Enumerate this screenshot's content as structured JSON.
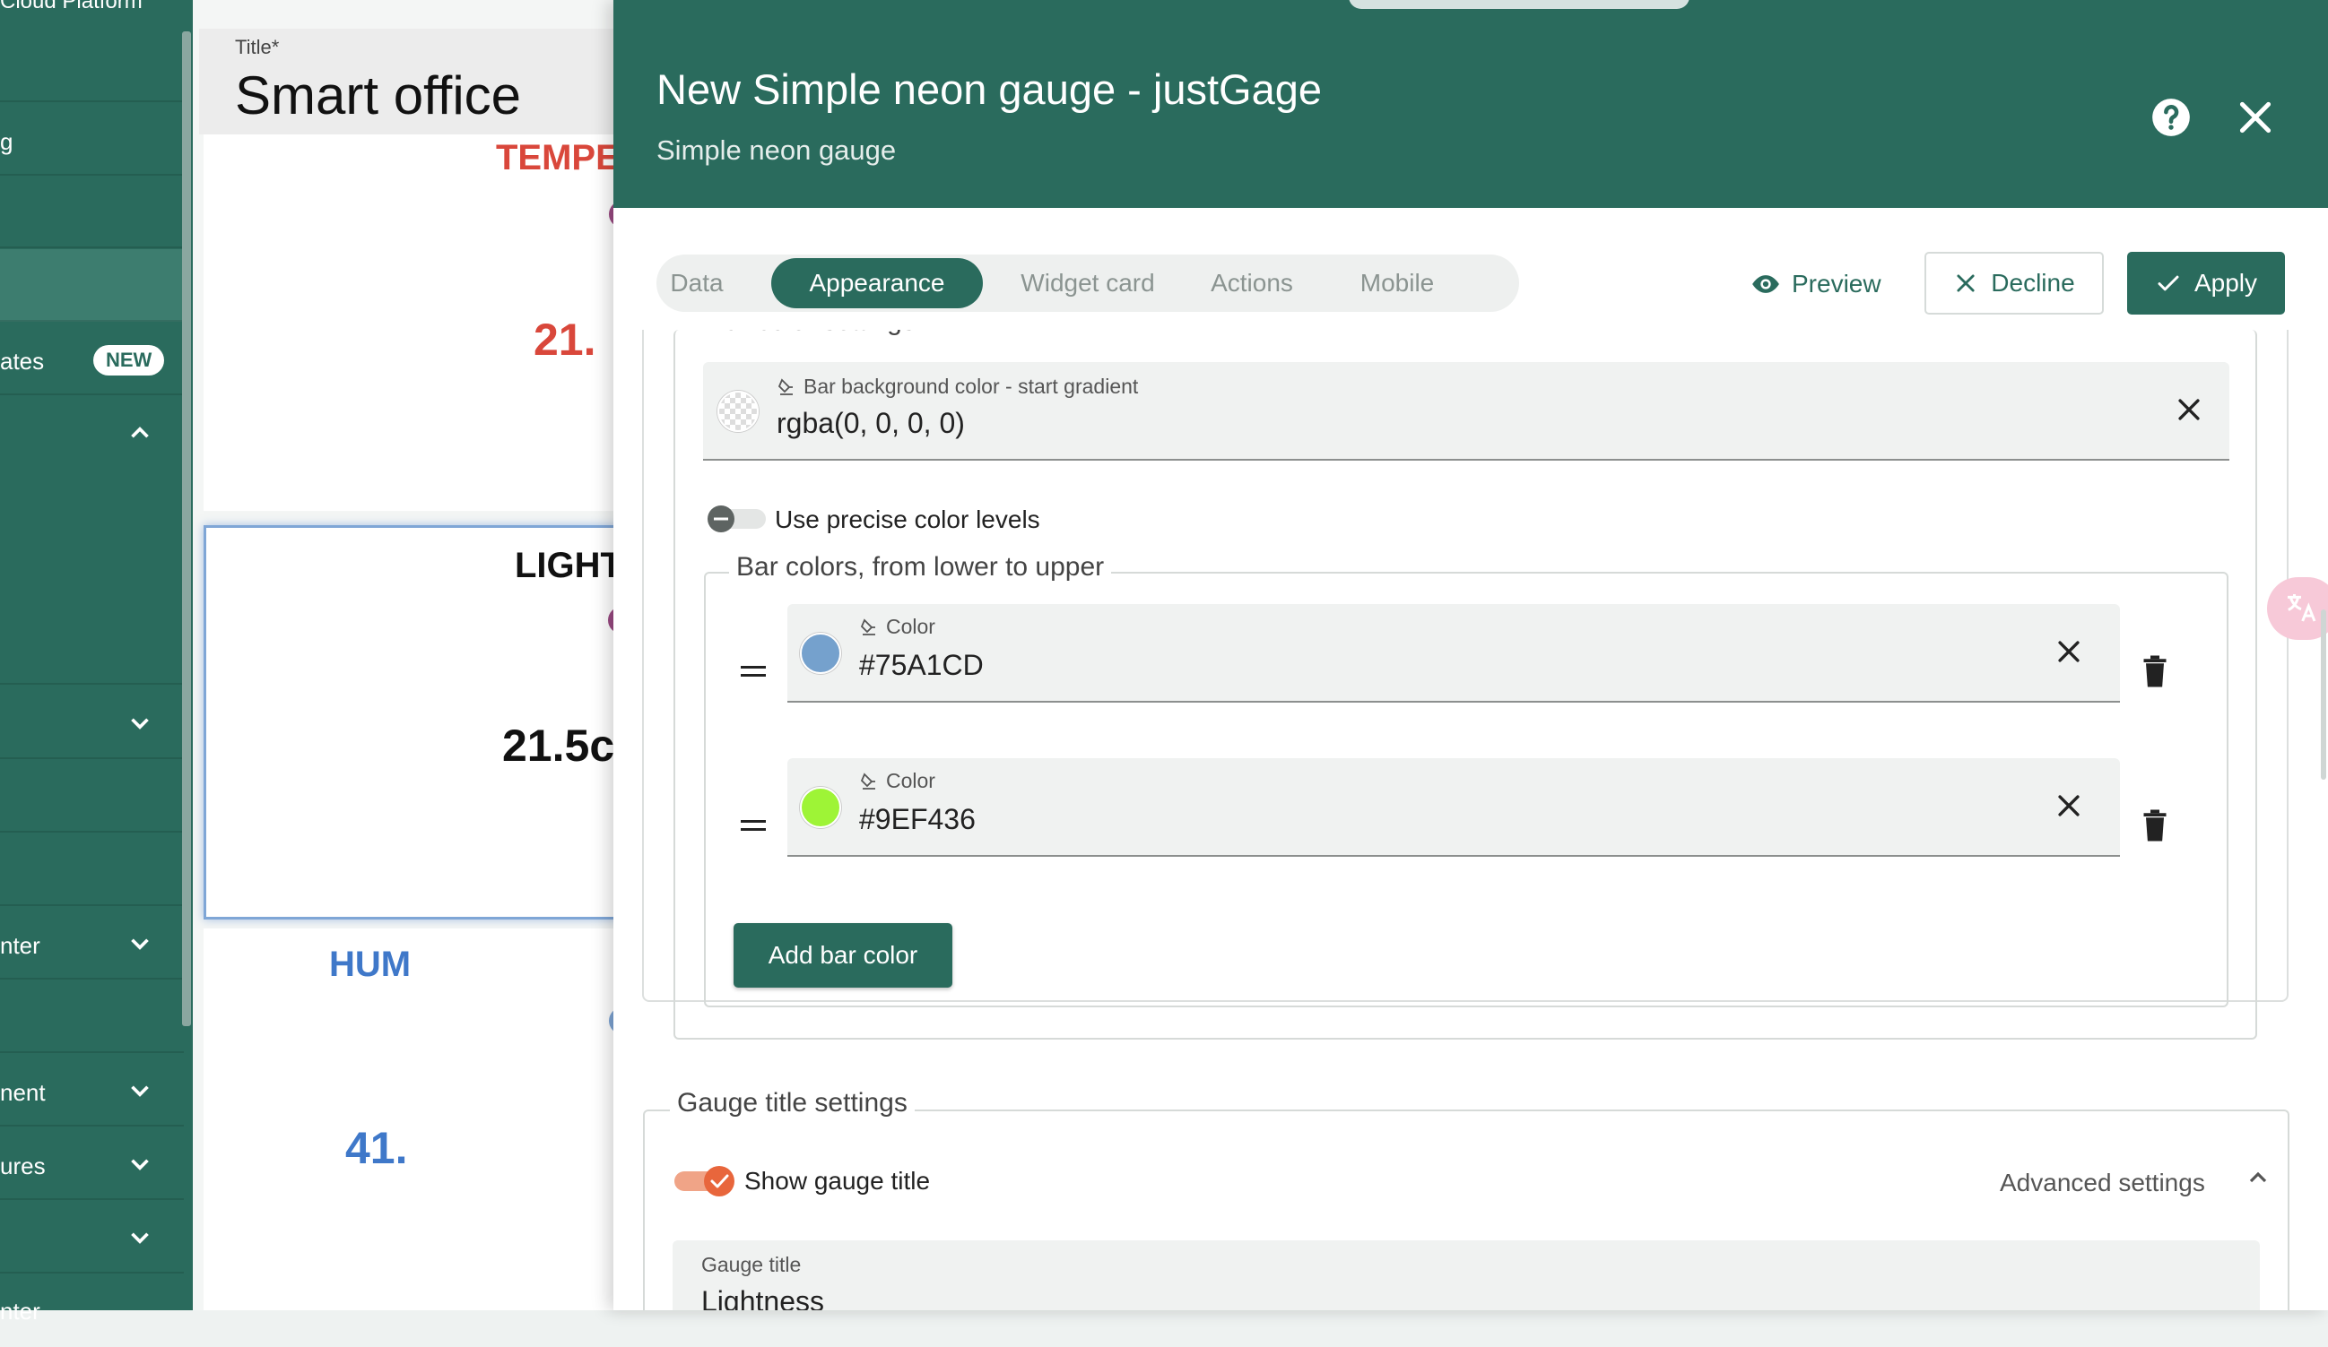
{
  "sidebar": {
    "brand": "Cloud Platform",
    "items": [
      {
        "label": ""
      },
      {
        "label": "g"
      },
      {
        "label": ""
      },
      {
        "label": "",
        "active": true
      },
      {
        "label": "ates",
        "badge": "NEW"
      },
      {
        "label": "",
        "chevron": "chevron-up"
      },
      {
        "label": "",
        "chevron": "chevron-down"
      },
      {
        "label": ""
      },
      {
        "label": ""
      },
      {
        "label": "nter",
        "chevron": "chevron-down"
      },
      {
        "label": ""
      },
      {
        "label": "nent",
        "chevron": "chevron-down"
      },
      {
        "label": "ures",
        "chevron": "chevron-down"
      },
      {
        "label": "",
        "chevron": "chevron-down"
      },
      {
        "label": "nter"
      }
    ]
  },
  "dashboard": {
    "title_caption": "Title*",
    "title_value": "Smart office",
    "cards": [
      {
        "title": "TEMPE",
        "value": "21.",
        "title_color": "#d9473b",
        "value_color": "#d9473b"
      },
      {
        "title": "LIGHT",
        "value": "21.5c",
        "title_color": "#111111",
        "value_color": "#111111"
      },
      {
        "title": "HUM",
        "value": "41.",
        "title_color": "#3f78c9",
        "value_color": "#3f78c9"
      }
    ]
  },
  "dialog": {
    "title": "New Simple neon gauge - justGage",
    "subtitle": "Simple neon gauge",
    "help_icon": "help-icon",
    "close_icon": "close-icon",
    "tabs": [
      {
        "label": "Data",
        "active": false
      },
      {
        "label": "Appearance",
        "active": true
      },
      {
        "label": "Widget card",
        "active": false
      },
      {
        "label": "Actions",
        "active": false
      },
      {
        "label": "Mobile",
        "active": false
      }
    ],
    "preview_label": "Preview",
    "decline_label": "Decline",
    "apply_label": "Apply"
  },
  "bar_color_settings": {
    "legend": "Bar color settings",
    "bg_start_label": "Bar background color - start gradient",
    "bg_start_value": "rgba(0, 0, 0, 0)",
    "precise_levels_label": "Use precise color levels",
    "precise_levels_on": false,
    "bar_colors_legend": "Bar colors, from lower to upper",
    "colors": [
      {
        "label": "Color",
        "value": "#75A1CD"
      },
      {
        "label": "Color",
        "value": "#9EF436"
      }
    ],
    "add_label": "Add bar color"
  },
  "gauge_title_settings": {
    "legend": "Gauge title settings",
    "show_label": "Show gauge title",
    "show_on": true,
    "advanced_label": "Advanced settings",
    "title_field_label": "Gauge title",
    "title_field_value": "Lightness"
  },
  "colors": {
    "primary": "#2a6b5d",
    "toggle_on": "#e8663c"
  }
}
